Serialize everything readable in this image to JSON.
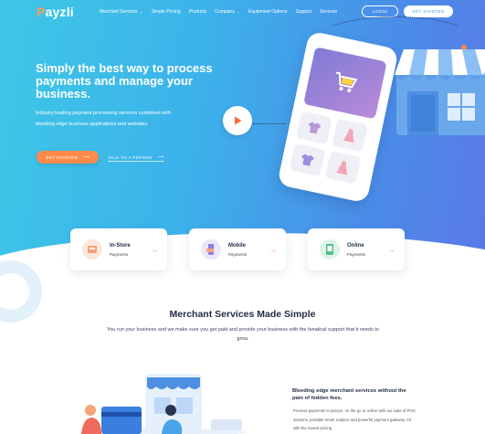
{
  "brand": {
    "name_prefix": "P",
    "name_rest": "ayzli",
    "accent": "#ff8a4c",
    "primary": "#3b9be8"
  },
  "nav": {
    "links": [
      {
        "label": "Merchant Services",
        "dropdown": true
      },
      {
        "label": "Simple Pricing",
        "dropdown": false
      },
      {
        "label": "Products",
        "dropdown": false
      },
      {
        "label": "Company",
        "dropdown": true
      },
      {
        "label": "Equipment Options",
        "dropdown": false
      },
      {
        "label": "Support",
        "dropdown": false
      },
      {
        "label": "Services",
        "dropdown": false
      }
    ],
    "login_label": "LOGIN",
    "get_started_label": "GET STARTED"
  },
  "hero": {
    "headline": "Simply the best way to process payments and manage your business.",
    "subtext": "Industry leading payment processing services combined with bleeding edge business applications and websites.",
    "cta_label": "GET STARTED",
    "talk_label": "TALK TO A PERSON"
  },
  "cards": [
    {
      "title": "In-Store",
      "subtitle": "Payments",
      "icon": "pos-terminal-icon"
    },
    {
      "title": "Mobile",
      "subtitle": "Payments",
      "icon": "mobile-card-icon"
    },
    {
      "title": "Online",
      "subtitle": "Payments",
      "icon": "online-store-icon"
    }
  ],
  "merchant": {
    "heading": "Merchant Services Made Simple",
    "paragraph": "You run your business and we make sure you get paid and provide your business with the fanatical support that it needs to grow."
  },
  "feature": {
    "heading": "Bleeding edge merchant services without the pain of hidden fees.",
    "paragraph": "Process payments in person, on the go or online with our suite of POS systems, portable smart readers and powerful payment gateway. All with the lowest pricing"
  }
}
